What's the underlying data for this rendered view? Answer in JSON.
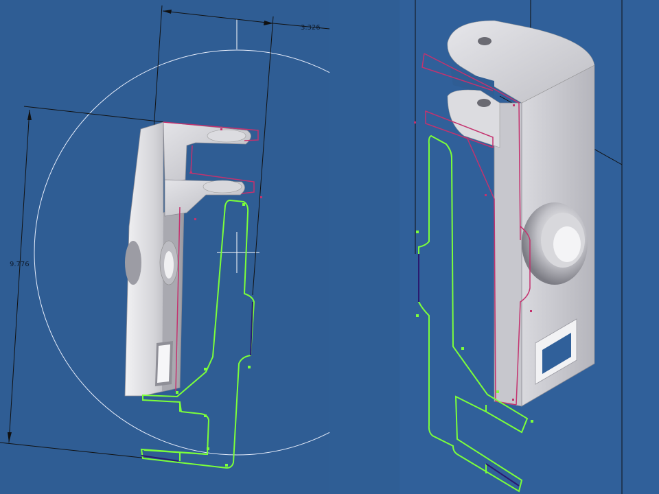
{
  "viewports": {
    "left": {
      "dimension_horizontal": "3.326",
      "dimension_vertical": "9.776"
    },
    "right": {}
  },
  "colors": {
    "background": "#2f5e95",
    "sketch_green": "#7cff3a",
    "projected_magenta": "#c4326e",
    "construction_white": "#ffffff",
    "dimension_black": "#111111",
    "part_gray": "#cfcfd2"
  }
}
